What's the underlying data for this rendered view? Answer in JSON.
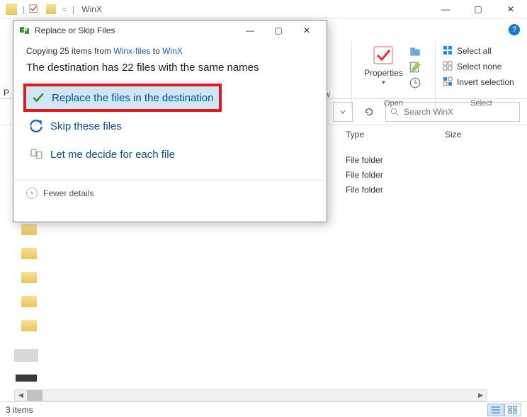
{
  "titlebar": {
    "title": "WinX"
  },
  "window_controls": {
    "min": "—",
    "max": "▢",
    "close": "✕"
  },
  "help": "?",
  "ribbon": {
    "properties_label": "Properties",
    "open_group": "Open",
    "select_group": "Select",
    "select_all": "Select all",
    "select_none": "Select none",
    "invert": "Invert selection",
    "view_frag_r": "r",
    "view_frag_iew": "iew",
    "p_frag": "P"
  },
  "navrow": {
    "search_placeholder": "Search WinX"
  },
  "columns": {
    "type": "Type",
    "size": "Size"
  },
  "files": [
    {
      "type": "File folder"
    },
    {
      "type": "File folder"
    },
    {
      "type": "File folder"
    }
  ],
  "status": {
    "count": "3 items"
  },
  "dialog": {
    "title": "Replace or Skip Files",
    "copying_prefix": "Copying 25 items from ",
    "src": "Winx-files",
    "to": " to ",
    "dst": "WinX",
    "headline": "The destination has 22 files with the same names",
    "opt_replace": "Replace the files in the destination",
    "opt_skip": "Skip these files",
    "opt_decide": "Let me decide for each file",
    "fewer": "Fewer details"
  }
}
